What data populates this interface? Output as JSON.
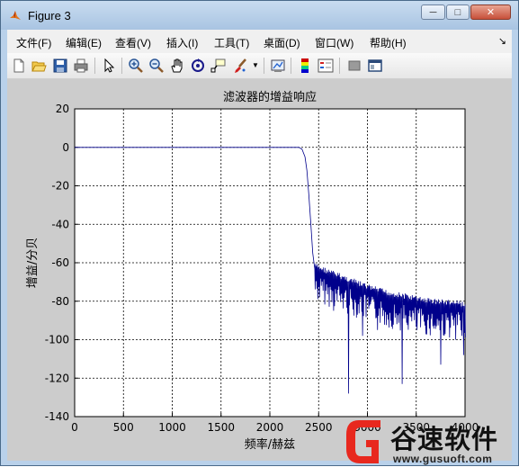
{
  "window": {
    "title": "Figure 3",
    "minimize_label": "─",
    "maximize_label": "□",
    "close_label": "✕"
  },
  "menu": {
    "items": [
      "文件(F)",
      "编辑(E)",
      "查看(V)",
      "插入(I)",
      "工具(T)",
      "桌面(D)",
      "窗口(W)",
      "帮助(H)"
    ],
    "overflow_label": "↘"
  },
  "toolbar": {
    "icons": [
      "new-figure-icon",
      "open-file-icon",
      "save-icon",
      "print-icon",
      "select-arrow-icon",
      "zoom-in-icon",
      "zoom-out-icon",
      "pan-hand-icon",
      "rotate-3d-icon",
      "data-cursor-icon",
      "brush-icon",
      "link-plot-icon",
      "colorbar-icon",
      "legend-icon",
      "hide-plot-tools-icon",
      "show-plot-tools-icon"
    ]
  },
  "colors": {
    "line": "#00008b",
    "figure_bg": "#cccccc",
    "axes_bg": "#ffffff",
    "watermark_red": "#e8281e"
  },
  "chart_data": {
    "type": "line",
    "title": "滤波器的增益响应",
    "xlabel": "频率/赫兹",
    "ylabel": "增益/分贝",
    "xlim": [
      0,
      4000
    ],
    "ylim": [
      -140,
      20
    ],
    "xticks": [
      0,
      500,
      1000,
      1500,
      2000,
      2500,
      3000,
      3500,
      4000
    ],
    "yticks": [
      20,
      0,
      -20,
      -40,
      -60,
      -80,
      -100,
      -120,
      -140
    ],
    "grid": true,
    "series": [
      {
        "passband": {
          "x": [
            0,
            2300,
            2330,
            2360,
            2380,
            2400,
            2420,
            2440,
            2460
          ],
          "y": [
            0,
            0,
            -1,
            -5,
            -12,
            -25,
            -40,
            -55,
            -63
          ]
        },
        "stopband_envelope": {
          "x": [
            2460,
            2600,
            2800,
            3000,
            3200,
            3400,
            3600,
            3800,
            4000
          ],
          "y": [
            -60,
            -63,
            -67,
            -71,
            -74,
            -76,
            -78,
            -79,
            -80
          ]
        },
        "notable_dips": [
          {
            "x": 2520,
            "y": -72
          },
          {
            "x": 2650,
            "y": -85
          },
          {
            "x": 2800,
            "y": -128
          },
          {
            "x": 2950,
            "y": -98
          },
          {
            "x": 3100,
            "y": -95
          },
          {
            "x": 3350,
            "y": -123
          },
          {
            "x": 3500,
            "y": -95
          },
          {
            "x": 3750,
            "y": -113
          },
          {
            "x": 3900,
            "y": -100
          },
          {
            "x": 3980,
            "y": -108
          }
        ]
      }
    ]
  },
  "watermark": {
    "name": "谷速软件",
    "url": "www.gusuoft.com"
  }
}
